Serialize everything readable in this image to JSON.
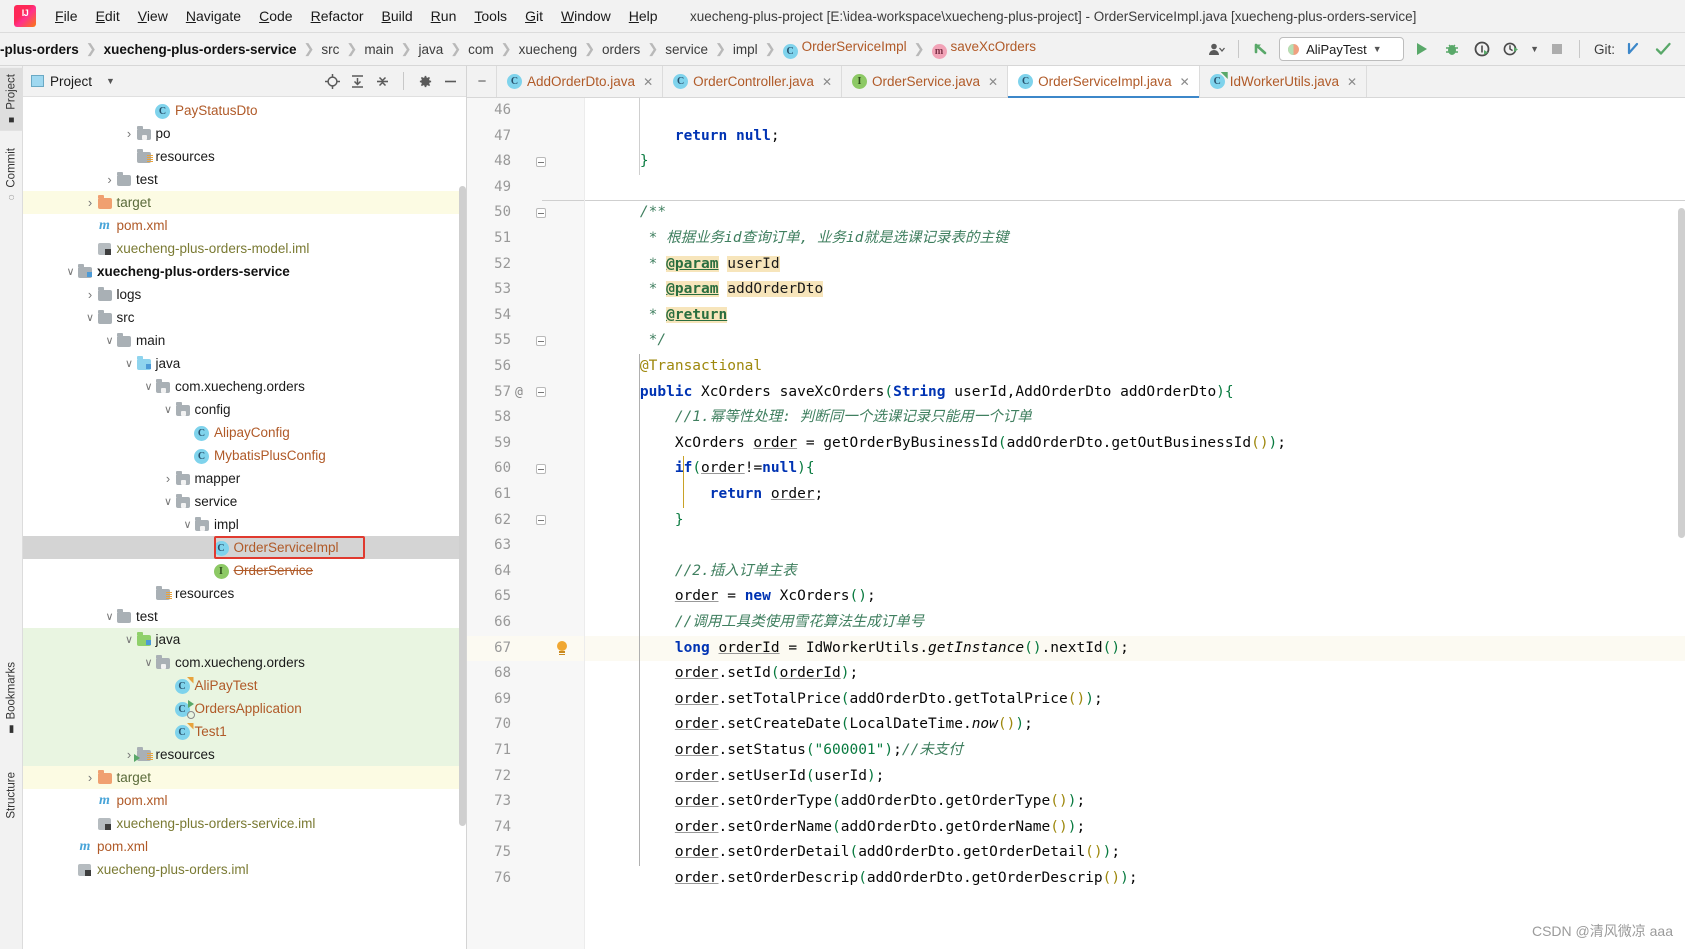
{
  "window": {
    "title": "xuecheng-plus-project [E:\\idea-workspace\\xuecheng-plus-project] - OrderServiceImpl.java [xuecheng-plus-orders-service]"
  },
  "menubar": {
    "items": [
      "File",
      "Edit",
      "View",
      "Navigate",
      "Code",
      "Refactor",
      "Build",
      "Run",
      "Tools",
      "Git",
      "Window",
      "Help"
    ]
  },
  "navbar": {
    "crumbs": [
      "-plus-orders",
      "xuecheng-plus-orders-service",
      "src",
      "main",
      "java",
      "com",
      "xuecheng",
      "orders",
      "service",
      "impl",
      "OrderServiceImpl",
      "saveXcOrders"
    ],
    "run_config": "AliPayTest",
    "git_label": "Git:"
  },
  "left_strip": {
    "tabs": [
      "Project",
      "Commit",
      "Bookmarks",
      "Structure"
    ]
  },
  "project_panel": {
    "title": "Project",
    "tree": [
      {
        "indent": 6,
        "arrow": "",
        "icon": "class",
        "name": "PayStatusDto",
        "style": "cls"
      },
      {
        "indent": 5,
        "arrow": ">",
        "icon": "pkg",
        "name": "po",
        "style": "dir"
      },
      {
        "indent": 5,
        "arrow": "",
        "icon": "res",
        "name": "resources",
        "style": "dir"
      },
      {
        "indent": 4,
        "arrow": ">",
        "icon": "gray",
        "name": "test",
        "style": "dir"
      },
      {
        "indent": 3,
        "arrow": ">",
        "icon": "orange",
        "name": "target",
        "style": "dir-y",
        "row": "yellow"
      },
      {
        "indent": 3,
        "arrow": "",
        "icon": "maven",
        "name": "pom.xml",
        "style": "file"
      },
      {
        "indent": 3,
        "arrow": "",
        "icon": "iml",
        "name": "xuecheng-plus-orders-model.iml",
        "style": "iml"
      },
      {
        "indent": 2,
        "arrow": "v",
        "icon": "srcmod",
        "name": "xuecheng-plus-orders-service",
        "style": "bold"
      },
      {
        "indent": 3,
        "arrow": ">",
        "icon": "gray",
        "name": "logs",
        "style": "dir"
      },
      {
        "indent": 3,
        "arrow": "v",
        "icon": "gray",
        "name": "src",
        "style": "dir"
      },
      {
        "indent": 4,
        "arrow": "v",
        "icon": "gray",
        "name": "main",
        "style": "dir"
      },
      {
        "indent": 5,
        "arrow": "v",
        "icon": "blue",
        "name": "java",
        "style": "dir"
      },
      {
        "indent": 6,
        "arrow": "v",
        "icon": "pkg",
        "name": "com.xuecheng.orders",
        "style": "dir"
      },
      {
        "indent": 7,
        "arrow": "v",
        "icon": "pkg",
        "name": "config",
        "style": "dir"
      },
      {
        "indent": 8,
        "arrow": "",
        "icon": "class",
        "name": "AlipayConfig",
        "style": "cls"
      },
      {
        "indent": 8,
        "arrow": "",
        "icon": "class",
        "name": "MybatisPlusConfig",
        "style": "cls"
      },
      {
        "indent": 7,
        "arrow": ">",
        "icon": "pkg",
        "name": "mapper",
        "style": "dir"
      },
      {
        "indent": 7,
        "arrow": "v",
        "icon": "pkg",
        "name": "service",
        "style": "dir"
      },
      {
        "indent": 8,
        "arrow": "v",
        "icon": "pkg",
        "name": "impl",
        "style": "dir"
      },
      {
        "indent": 9,
        "arrow": "",
        "icon": "class",
        "name": "OrderServiceImpl",
        "style": "cls",
        "row": "selected",
        "highlight_box": true
      },
      {
        "indent": 9,
        "arrow": "",
        "icon": "interface",
        "name": "OrderService",
        "style": "cls-strike"
      },
      {
        "indent": 6,
        "arrow": "",
        "icon": "res",
        "name": "resources",
        "style": "dir"
      },
      {
        "indent": 4,
        "arrow": "v",
        "icon": "gray",
        "name": "test",
        "style": "dir"
      },
      {
        "indent": 5,
        "arrow": "v",
        "icon": "green",
        "name": "java",
        "style": "dir",
        "row": "green"
      },
      {
        "indent": 6,
        "arrow": "v",
        "icon": "pkg",
        "name": "com.xuecheng.orders",
        "style": "dir",
        "row": "green"
      },
      {
        "indent": 7,
        "arrow": "",
        "icon": "class-run",
        "name": "AliPayTest",
        "style": "cls",
        "row": "green"
      },
      {
        "indent": 7,
        "arrow": "",
        "icon": "class-spring",
        "name": "OrdersApplication",
        "style": "cls",
        "row": "green"
      },
      {
        "indent": 7,
        "arrow": "",
        "icon": "class-run",
        "name": "Test1",
        "style": "cls",
        "row": "green"
      },
      {
        "indent": 5,
        "arrow": ">",
        "icon": "res-test",
        "name": "resources",
        "style": "dir",
        "row": "green"
      },
      {
        "indent": 3,
        "arrow": ">",
        "icon": "orange",
        "name": "target",
        "style": "dir-y",
        "row": "yellow"
      },
      {
        "indent": 3,
        "arrow": "",
        "icon": "maven",
        "name": "pom.xml",
        "style": "file"
      },
      {
        "indent": 3,
        "arrow": "",
        "icon": "iml",
        "name": "xuecheng-plus-orders-service.iml",
        "style": "iml"
      },
      {
        "indent": 2,
        "arrow": "",
        "icon": "maven",
        "name": "pom.xml",
        "style": "file"
      },
      {
        "indent": 2,
        "arrow": "",
        "icon": "iml",
        "name": "xuecheng-plus-orders.iml",
        "style": "iml"
      }
    ]
  },
  "editor": {
    "tabs": [
      {
        "label": "AddOrderDto.java",
        "icon": "class",
        "active": false
      },
      {
        "label": "OrderController.java",
        "icon": "class",
        "active": false
      },
      {
        "label": "OrderService.java",
        "icon": "interface",
        "active": false
      },
      {
        "label": "OrderServiceImpl.java",
        "icon": "class",
        "active": true
      },
      {
        "label": "IdWorkerUtils.java",
        "icon": "class-run",
        "active": false
      }
    ],
    "first_line_number": 46,
    "lines": [
      {
        "n": 46,
        "code": ""
      },
      {
        "n": 47,
        "code": "        return null;"
      },
      {
        "n": 48,
        "code": "    }",
        "fold": true
      },
      {
        "n": 49,
        "code": ""
      },
      {
        "n": 50,
        "code": "    /**",
        "fold": true
      },
      {
        "n": 51,
        "code": "     * 根据业务id查询订单, 业务id就是选课记录表的主键"
      },
      {
        "n": 52,
        "code": "     * @param userId"
      },
      {
        "n": 53,
        "code": "     * @param addOrderDto"
      },
      {
        "n": 54,
        "code": "     * @return"
      },
      {
        "n": 55,
        "code": "     */",
        "fold": true
      },
      {
        "n": 56,
        "code": "    @Transactional"
      },
      {
        "n": 57,
        "code": "    public XcOrders saveXcOrders(String userId,AddOrderDto addOrderDto){",
        "fold": true,
        "at": "@"
      },
      {
        "n": 58,
        "code": "        //1.幂等性处理: 判断同一个选课记录只能用一个订单"
      },
      {
        "n": 59,
        "code": "        XcOrders order = getOrderByBusinessId(addOrderDto.getOutBusinessId());"
      },
      {
        "n": 60,
        "code": "        if(order!=null){",
        "fold": true
      },
      {
        "n": 61,
        "code": "            return order;"
      },
      {
        "n": 62,
        "code": "        }",
        "fold": true
      },
      {
        "n": 63,
        "code": ""
      },
      {
        "n": 64,
        "code": "        //2.插入订单主表"
      },
      {
        "n": 65,
        "code": "        order = new XcOrders();"
      },
      {
        "n": 66,
        "code": "        //调用工具类使用雪花算法生成订单号"
      },
      {
        "n": 67,
        "code": "        long orderId = IdWorkerUtils.getInstance().nextId();",
        "bulb": true,
        "current": true
      },
      {
        "n": 68,
        "code": "        order.setId(orderId);"
      },
      {
        "n": 69,
        "code": "        order.setTotalPrice(addOrderDto.getTotalPrice());"
      },
      {
        "n": 70,
        "code": "        order.setCreateDate(LocalDateTime.now());"
      },
      {
        "n": 71,
        "code": "        order.setStatus(\"600001\");//未支付"
      },
      {
        "n": 72,
        "code": "        order.setUserId(userId);"
      },
      {
        "n": 73,
        "code": "        order.setOrderType(addOrderDto.getOrderType());"
      },
      {
        "n": 74,
        "code": "        order.setOrderName(addOrderDto.getOrderName());"
      },
      {
        "n": 75,
        "code": "        order.setOrderDetail(addOrderDto.getOrderDetail());"
      },
      {
        "n": 76,
        "code": "        order.setOrderDescrip(addOrderDto.getOrderDescrip());"
      }
    ]
  },
  "watermark": "CSDN @清风微凉 aaa",
  "colors": {
    "accent_blue": "#3c87c9",
    "keyword": "#0033b3",
    "comment": "#3f7f5f",
    "string": "#087a3f",
    "annotation": "#9e880d",
    "class_name": "#b05a28",
    "highlight_param": "#f7e5bb",
    "selection_row": "#d4d4d4",
    "test_root": "#e9f5e1",
    "excluded_root": "#fcfbe3",
    "red_box": "#e03a2f"
  }
}
